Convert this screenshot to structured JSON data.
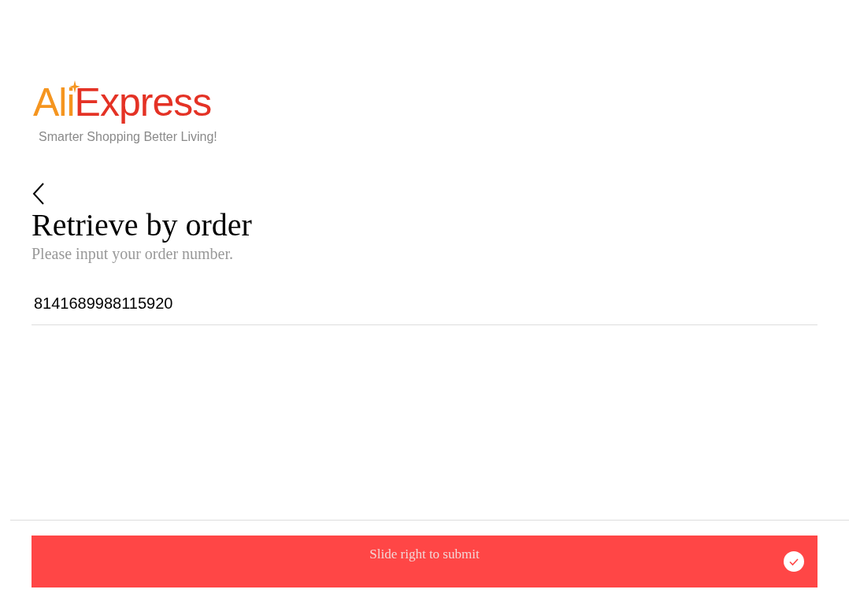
{
  "logo": {
    "part_1": "Ali",
    "part_2": "Express",
    "tagline": "Smarter Shopping Better Living!"
  },
  "title": "Retrieve by order",
  "subtitle": "Please input your order number.",
  "order_field": {
    "value": "8141689988115920"
  },
  "slider": {
    "label": "Slide right to submit"
  }
}
